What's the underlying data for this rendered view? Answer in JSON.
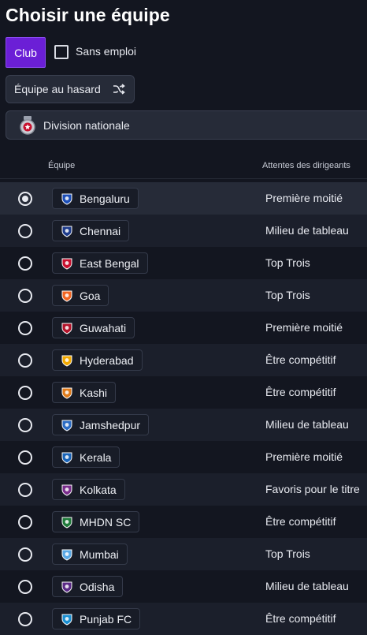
{
  "page": {
    "title": "Choisir une équipe"
  },
  "filters": {
    "club_label": "Club",
    "unemployed_label": "Sans emploi",
    "unemployed_checked": false,
    "random_team_label": "Équipe au hasard",
    "division_label": "Division nationale"
  },
  "table": {
    "col_team": "Équipe",
    "col_expectations": "Attentes des dirigeants",
    "rows": [
      {
        "team": "Bengaluru",
        "expectation": "Première moitié",
        "selected": true,
        "crest_color": "#1d4fb8"
      },
      {
        "team": "Chennai",
        "expectation": "Milieu de tableau",
        "selected": false,
        "crest_color": "#1e3c8c"
      },
      {
        "team": "East Bengal",
        "expectation": "Top Trois",
        "selected": false,
        "crest_color": "#c8102e"
      },
      {
        "team": "Goa",
        "expectation": "Top Trois",
        "selected": false,
        "crest_color": "#f26522"
      },
      {
        "team": "Guwahati",
        "expectation": "Première moitié",
        "selected": false,
        "crest_color": "#b3142b"
      },
      {
        "team": "Hyderabad",
        "expectation": "Être compétitif",
        "selected": false,
        "crest_color": "#f2a900"
      },
      {
        "team": "Kashi",
        "expectation": "Être compétitif",
        "selected": false,
        "crest_color": "#e07b1a"
      },
      {
        "team": "Jamshedpur",
        "expectation": "Milieu de tableau",
        "selected": false,
        "crest_color": "#2b6cc4"
      },
      {
        "team": "Kerala",
        "expectation": "Première moitié",
        "selected": false,
        "crest_color": "#1a64b8"
      },
      {
        "team": "Kolkata",
        "expectation": "Favoris pour le titre",
        "selected": false,
        "crest_color": "#7a2d8c"
      },
      {
        "team": "MHDN SC",
        "expectation": "Être compétitif",
        "selected": false,
        "crest_color": "#1f7a3a"
      },
      {
        "team": "Mumbai",
        "expectation": "Top Trois",
        "selected": false,
        "crest_color": "#5aa9e6"
      },
      {
        "team": "Odisha",
        "expectation": "Milieu de tableau",
        "selected": false,
        "crest_color": "#5b2a86"
      },
      {
        "team": "Punjab FC",
        "expectation": "Être compétitif",
        "selected": false,
        "crest_color": "#1b8fd1"
      }
    ]
  }
}
